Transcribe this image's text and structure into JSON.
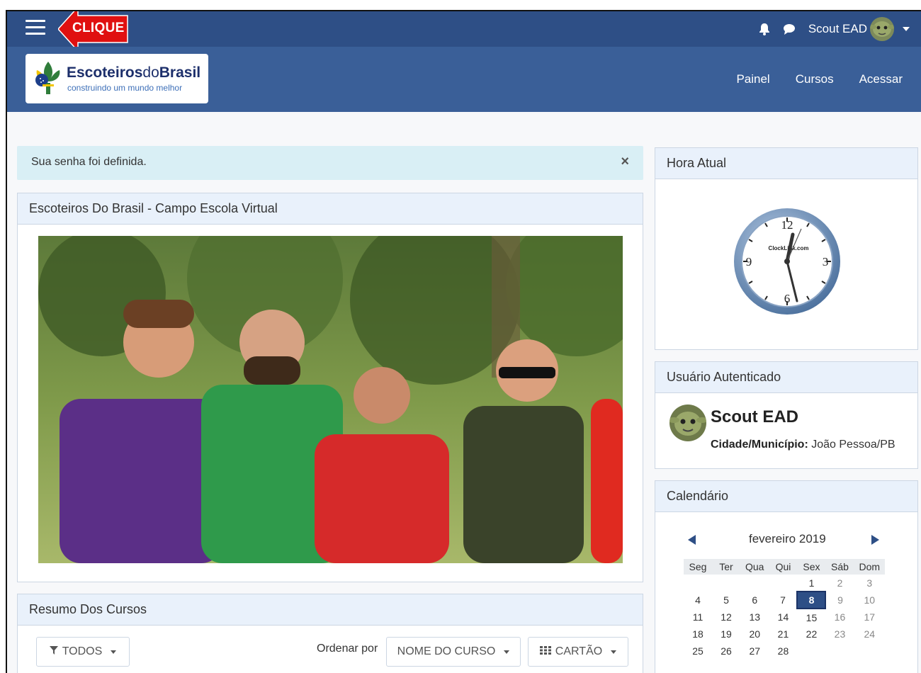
{
  "topbar": {
    "annotation": "CLIQUE",
    "user_name": "Scout EAD"
  },
  "brand": {
    "title_bold": "Escoteiros",
    "title_thin": "do",
    "title_bold2": "Brasil",
    "subtitle": "construindo um mundo melhor"
  },
  "nav": {
    "painel": "Painel",
    "cursos": "Cursos",
    "acessar": "Acessar"
  },
  "alert": {
    "message": "Sua senha foi definida.",
    "close": "×"
  },
  "main": {
    "title": "Escoteiros Do Brasil - Campo Escola Virtual"
  },
  "summary": {
    "title": "Resumo Dos Cursos",
    "filter_label": "TODOS",
    "sort_label": "Ordenar por",
    "sort_value": "NOME DO CURSO",
    "view_label": "CARTÃO"
  },
  "clock": {
    "title": "Hora Atual",
    "brand": "ClockLink.com",
    "num12": "12",
    "num3": "3",
    "num6": "6",
    "num9": "9"
  },
  "user": {
    "title": "Usuário Autenticado",
    "name": "Scout EAD",
    "city_label": "Cidade/Município:",
    "city_value": "João Pessoa/PB"
  },
  "calendar": {
    "title": "Calendário",
    "month": "fevereiro 2019",
    "weekdays": [
      "Seg",
      "Ter",
      "Qua",
      "Qui",
      "Sex",
      "Sáb",
      "Dom"
    ],
    "weeks": [
      [
        "",
        "",
        "",
        "",
        "1",
        "2",
        "3"
      ],
      [
        "4",
        "5",
        "6",
        "7",
        "8",
        "9",
        "10"
      ],
      [
        "11",
        "12",
        "13",
        "14",
        "15",
        "16",
        "17"
      ],
      [
        "18",
        "19",
        "20",
        "21",
        "22",
        "23",
        "24"
      ],
      [
        "25",
        "26",
        "27",
        "28",
        "",
        "",
        ""
      ]
    ],
    "today": "8"
  },
  "colors": {
    "topbar": "#2e4f86",
    "brandbar": "#3a5f98",
    "alert_bg": "#d9eff5",
    "card_header_bg": "#e9f1fb",
    "annotation_red": "#e01010"
  }
}
